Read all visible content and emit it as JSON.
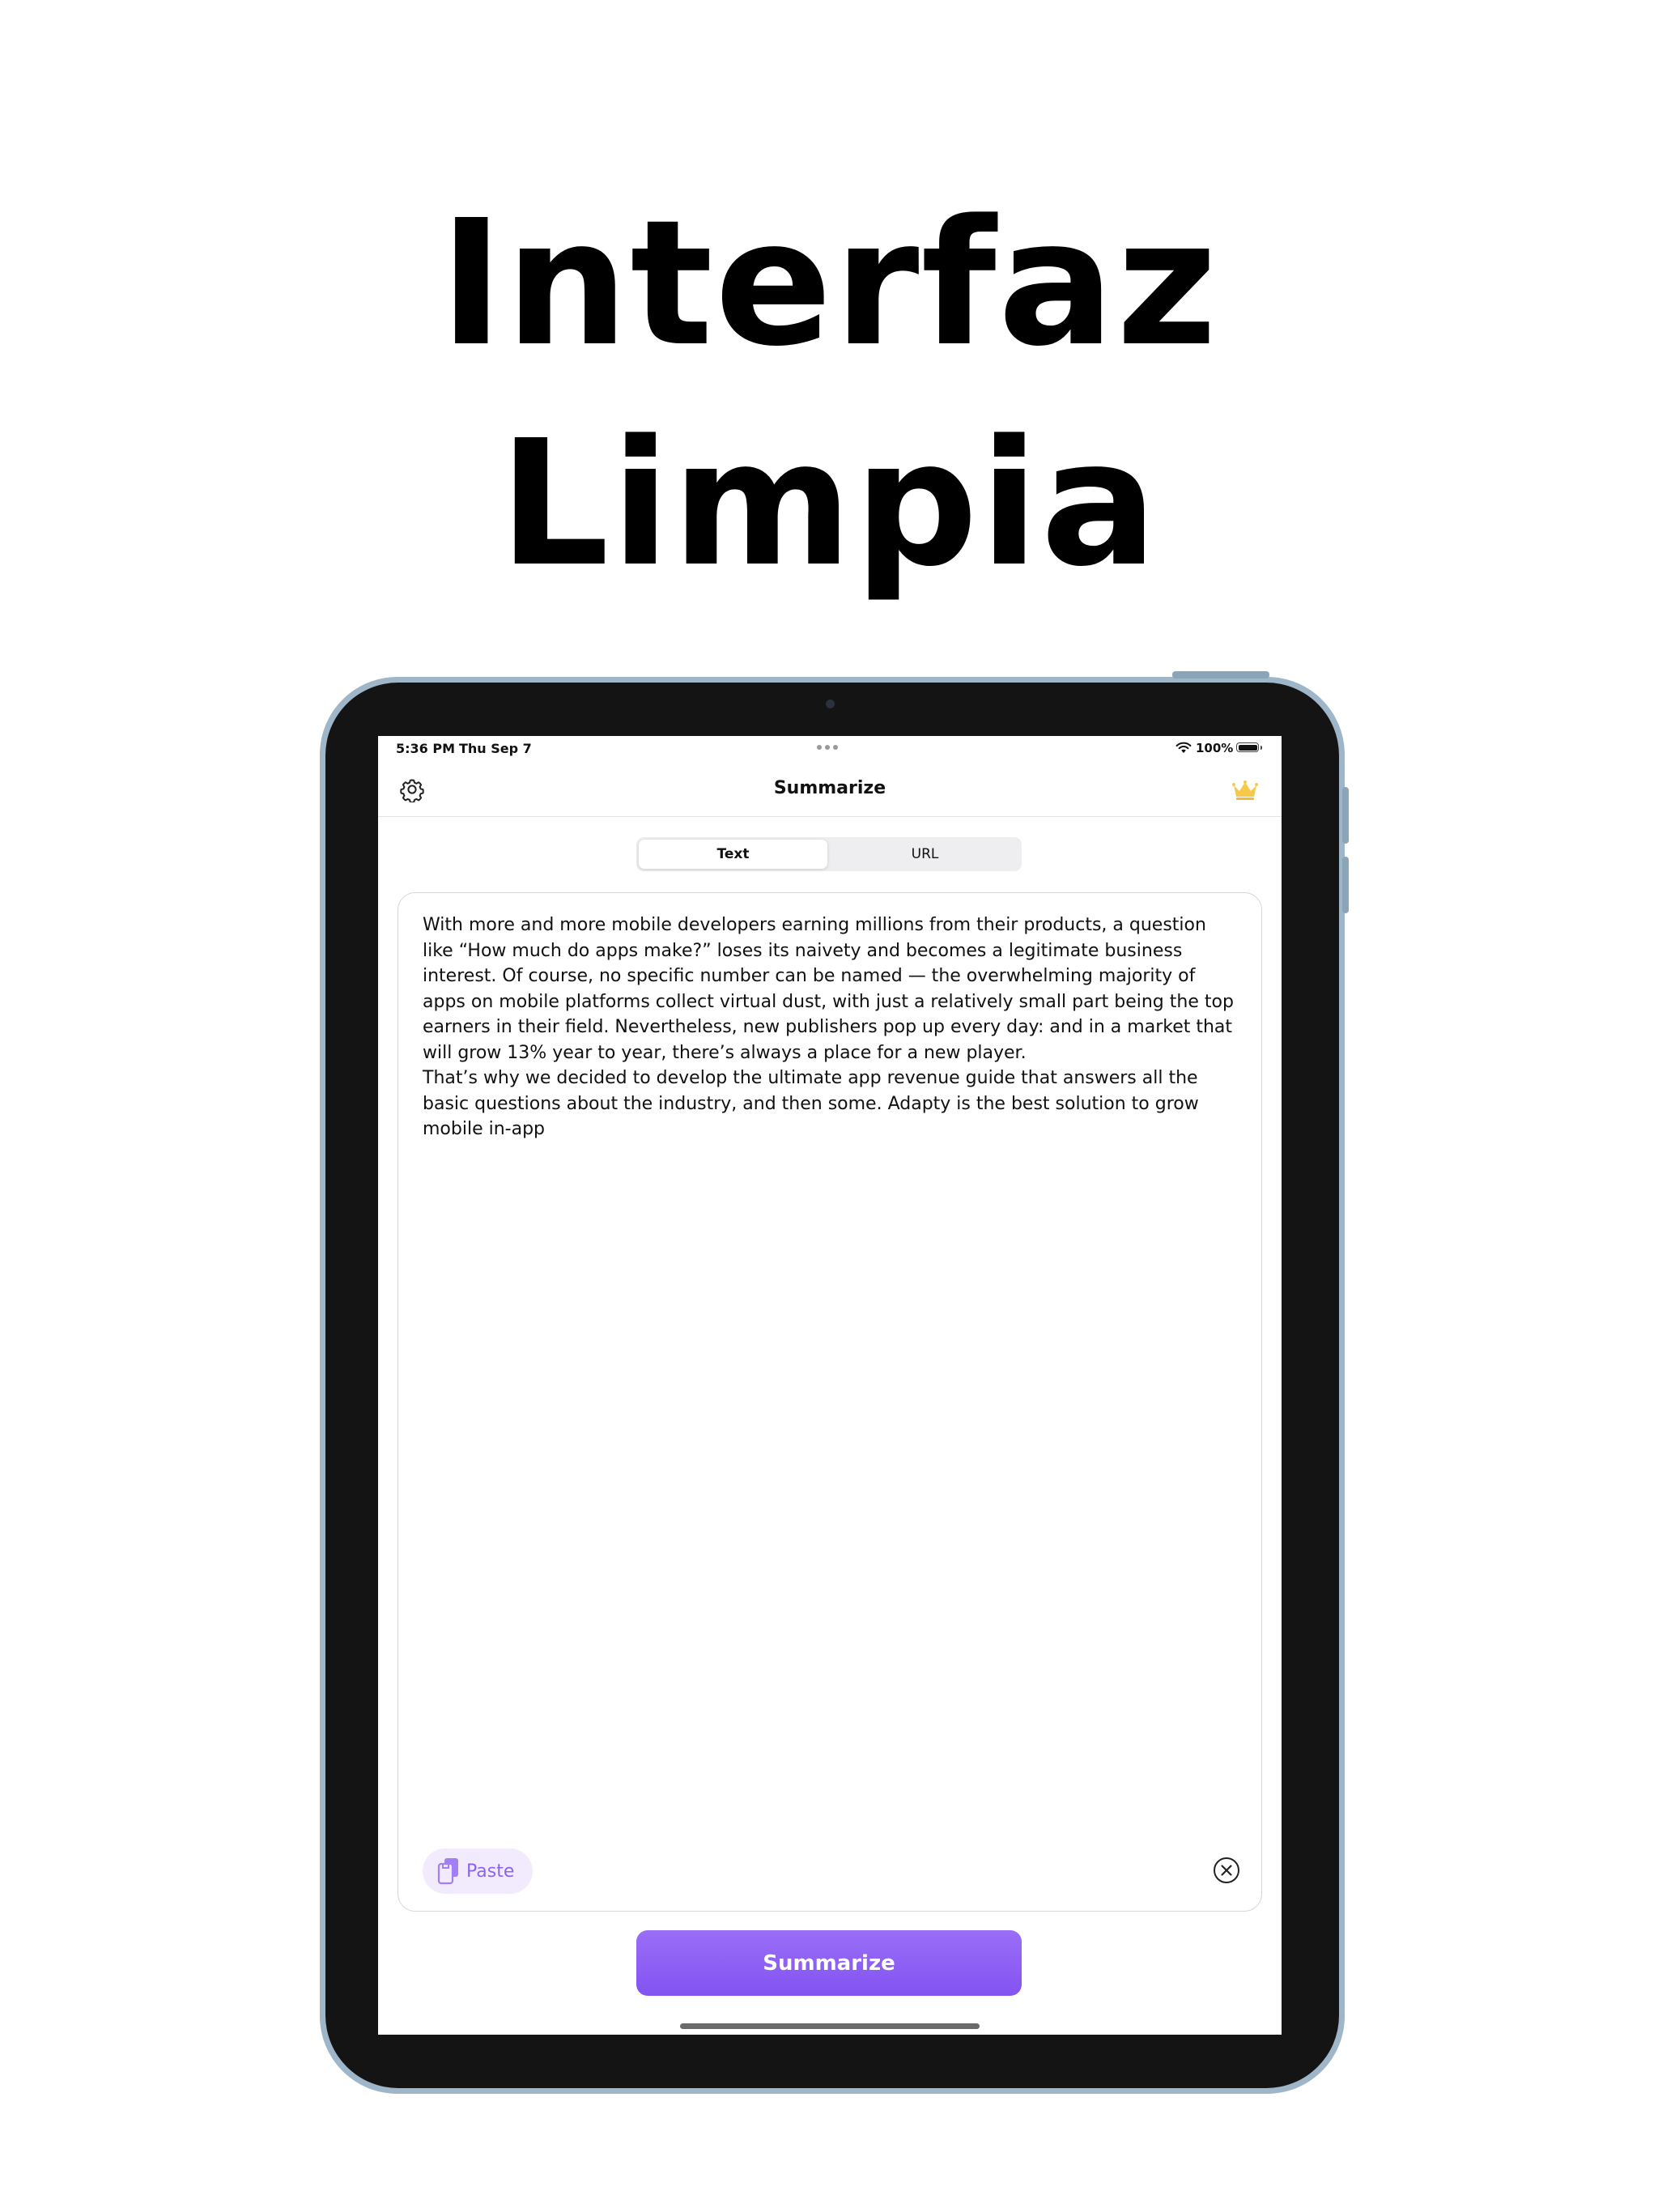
{
  "headline": {
    "line1": "Interfaz",
    "line2": "Limpia"
  },
  "status_bar": {
    "time": "5:36 PM",
    "date": "Thu Sep 7",
    "battery": "100%"
  },
  "nav": {
    "title": "Summarize",
    "settings_icon": "gear-icon",
    "premium_icon": "crown-icon"
  },
  "segmented": {
    "tabs": [
      {
        "label": "Text",
        "selected": true
      },
      {
        "label": "URL",
        "selected": false
      }
    ]
  },
  "editor": {
    "text": "With more and more mobile developers earning millions from their products, a question like “How much do apps make?” loses its naivety and becomes a legitimate business interest. Of course, no specific number can be named — the overwhelming majority of apps on mobile platforms collect virtual dust, with just a relatively small part being the top earners in their field. Nevertheless, new publishers pop up every day: and in a market that will grow 13% year to year, there’s always a place for a new player.\nThat’s why we decided to develop the ultimate app revenue guide that answers all the basic questions about the industry, and then some. Adapty is the best solution to grow mobile in-app",
    "paste_label": "Paste",
    "clear_icon": "close-circle-icon"
  },
  "actions": {
    "summarize_label": "Summarize"
  },
  "colors": {
    "accent": "#8d63f0",
    "crown": "#f7c948",
    "device_frame": "#9fb6c8",
    "bezel": "#141414"
  }
}
